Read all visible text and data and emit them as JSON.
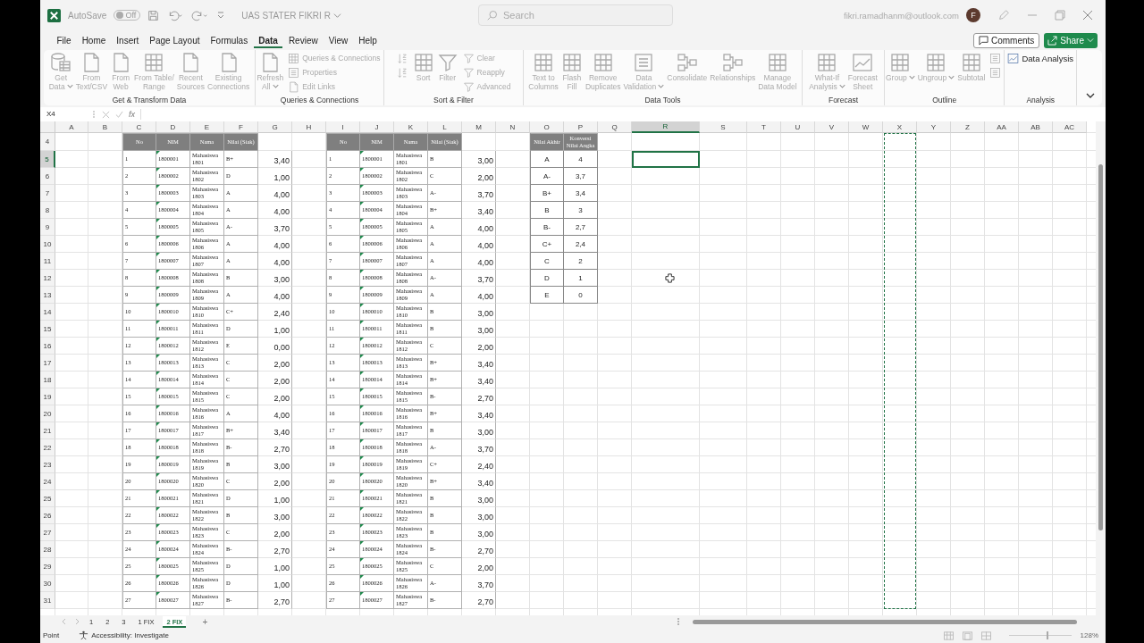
{
  "title_bar": {
    "autosave_label": "AutoSave",
    "autosave": {
      "label": "Off",
      "on": false
    },
    "file_name": "UAS STATER FIKRI R",
    "search": {
      "placeholder": "Search"
    },
    "account": "fikri.ramadhanm@outlook.com",
    "avatar": "F"
  },
  "menu_tabs": [
    {
      "label": "File",
      "selected": false
    },
    {
      "label": "Home",
      "selected": false
    },
    {
      "label": "Insert",
      "selected": false
    },
    {
      "label": "Page Layout",
      "selected": false
    },
    {
      "label": "Formulas",
      "selected": false
    },
    {
      "label": "Data",
      "selected": true
    },
    {
      "label": "Review",
      "selected": false
    },
    {
      "label": "View",
      "selected": false
    },
    {
      "label": "Help",
      "selected": false
    }
  ],
  "comments": "Comments",
  "share": "Share",
  "ribbon": [
    {
      "label": "Get & Transform Data",
      "items": [
        {
          "kind": "large",
          "label": "Get\nData",
          "menu": true,
          "disabled": true
        },
        {
          "kind": "large",
          "label": "From\nText/CSV",
          "menu": false,
          "disabled": true
        },
        {
          "kind": "large",
          "label": "From\nWeb",
          "menu": false,
          "disabled": true
        },
        {
          "kind": "large",
          "label": "From Table/\nRange",
          "menu": false,
          "disabled": true
        },
        {
          "kind": "large",
          "label": "Recent\nSources",
          "menu": false,
          "disabled": true
        },
        {
          "kind": "large",
          "label": "Existing\nConnections",
          "menu": false,
          "disabled": true
        }
      ]
    },
    {
      "label": "Queries & Connections",
      "items": [
        {
          "kind": "large",
          "label": "Refresh\nAll",
          "menu": true,
          "disabled": true
        },
        {
          "kind": "stack",
          "items": [
            {
              "label": "Queries & Connections",
              "disabled": true
            },
            {
              "label": "Properties",
              "disabled": true
            },
            {
              "label": "Edit Links",
              "disabled": true
            }
          ]
        }
      ]
    },
    {
      "label": "Sort & Filter",
      "items": [
        {
          "kind": "stack",
          "items": [
            {
              "disabled": true
            },
            {
              "disabled": true
            }
          ]
        },
        {
          "kind": "large",
          "label": "Sort",
          "menu": false,
          "disabled": true
        },
        {
          "kind": "large",
          "label": "Filter",
          "menu": false,
          "disabled": true
        },
        {
          "kind": "stack",
          "items": [
            {
              "label": "Clear",
              "disabled": true
            },
            {
              "label": "Reapply",
              "disabled": true
            },
            {
              "label": "Advanced",
              "disabled": true
            }
          ]
        }
      ]
    },
    {
      "label": "Data Tools",
      "items": [
        {
          "kind": "large",
          "label": "Text to\nColumns",
          "menu": false,
          "disabled": true
        },
        {
          "kind": "large",
          "label": "Flash\nFill",
          "menu": false,
          "disabled": true
        },
        {
          "kind": "large",
          "label": "Remove\nDuplicates",
          "menu": false,
          "disabled": true
        },
        {
          "kind": "large",
          "label": "Data\nValidation",
          "menu": true,
          "disabled": true
        },
        {
          "kind": "large",
          "label": "Consolidate",
          "menu": false,
          "disabled": true
        },
        {
          "kind": "large",
          "label": "Relationships",
          "menu": false,
          "disabled": true
        },
        {
          "kind": "large",
          "label": "Manage\nData Model",
          "menu": false,
          "disabled": true
        }
      ]
    },
    {
      "label": "Forecast",
      "items": [
        {
          "kind": "large",
          "label": "What-If\nAnalysis",
          "menu": true,
          "disabled": true
        },
        {
          "kind": "large",
          "label": "Forecast\nSheet",
          "menu": false,
          "disabled": true
        }
      ]
    },
    {
      "label": "Outline",
      "items": [
        {
          "kind": "large",
          "label": "Group",
          "menu": true,
          "disabled": true
        },
        {
          "kind": "large",
          "label": "Ungroup",
          "menu": true,
          "disabled": true
        },
        {
          "kind": "large",
          "label": "Subtotal",
          "menu": false,
          "disabled": true
        },
        {
          "kind": "stack",
          "items": [
            {
              "disabled": true
            },
            {
              "disabled": true
            }
          ]
        }
      ]
    },
    {
      "label": "Analysis",
      "items": [
        {
          "kind": "stack",
          "items": [
            {
              "label": "Data Analysis",
              "disabled": false
            }
          ]
        }
      ]
    }
  ],
  "formula_bar": {
    "name_box": "X4",
    "fx": "fx"
  },
  "sheet": {
    "column_headers": [
      {
        "label": "A",
        "selected": false,
        "copied": false
      },
      {
        "label": "B",
        "selected": false,
        "copied": false
      },
      {
        "label": "C",
        "selected": false,
        "copied": false
      },
      {
        "label": "D",
        "selected": false,
        "copied": false
      },
      {
        "label": "E",
        "selected": false,
        "copied": false
      },
      {
        "label": "F",
        "selected": false,
        "copied": false
      },
      {
        "label": "G",
        "selected": false,
        "copied": false
      },
      {
        "label": "H",
        "selected": false,
        "copied": false
      },
      {
        "label": "I",
        "selected": false,
        "copied": false
      },
      {
        "label": "J",
        "selected": false,
        "copied": false
      },
      {
        "label": "K",
        "selected": false,
        "copied": false
      },
      {
        "label": "L",
        "selected": false,
        "copied": false
      },
      {
        "label": "M",
        "selected": false,
        "copied": false
      },
      {
        "label": "N",
        "selected": false,
        "copied": false
      },
      {
        "label": "O",
        "selected": false,
        "copied": false
      },
      {
        "label": "P",
        "selected": false,
        "copied": false
      },
      {
        "label": "Q",
        "selected": false,
        "copied": false
      },
      {
        "label": "R",
        "selected": true,
        "copied": false
      },
      {
        "label": "S",
        "selected": false,
        "copied": false
      },
      {
        "label": "T",
        "selected": false,
        "copied": false
      },
      {
        "label": "U",
        "selected": false,
        "copied": false
      },
      {
        "label": "V",
        "selected": false,
        "copied": false
      },
      {
        "label": "W",
        "selected": false,
        "copied": false
      },
      {
        "label": "X",
        "selected": false,
        "copied": true
      },
      {
        "label": "Y",
        "selected": false,
        "copied": false
      },
      {
        "label": "Z",
        "selected": false,
        "copied": false
      },
      {
        "label": "AA",
        "selected": false,
        "copied": false
      },
      {
        "label": "AB",
        "selected": false,
        "copied": false
      },
      {
        "label": "AC",
        "selected": false,
        "copied": false
      }
    ],
    "row_headers": [
      {
        "label": "4",
        "selected": false
      },
      {
        "label": "5",
        "selected": true
      },
      {
        "label": "6",
        "selected": false
      },
      {
        "label": "7",
        "selected": false
      },
      {
        "label": "8",
        "selected": false
      },
      {
        "label": "9",
        "selected": false
      },
      {
        "label": "10",
        "selected": false
      },
      {
        "label": "11",
        "selected": false
      },
      {
        "label": "12",
        "selected": false
      },
      {
        "label": "13",
        "selected": false
      },
      {
        "label": "14",
        "selected": false
      },
      {
        "label": "15",
        "selected": false
      },
      {
        "label": "16",
        "selected": false
      },
      {
        "label": "17",
        "selected": false
      },
      {
        "label": "18",
        "selected": false
      },
      {
        "label": "19",
        "selected": false
      },
      {
        "label": "20",
        "selected": false
      },
      {
        "label": "21",
        "selected": false
      },
      {
        "label": "22",
        "selected": false
      },
      {
        "label": "23",
        "selected": false
      },
      {
        "label": "24",
        "selected": false
      },
      {
        "label": "25",
        "selected": false
      },
      {
        "label": "26",
        "selected": false
      },
      {
        "label": "27",
        "selected": false
      },
      {
        "label": "28",
        "selected": false
      },
      {
        "label": "29",
        "selected": false
      },
      {
        "label": "30",
        "selected": false
      },
      {
        "label": "31",
        "selected": false
      }
    ],
    "tables": [
      {
        "columns": [
          "No",
          "NIM",
          "Nama",
          "Nilai (Siak)"
        ],
        "rows": [
          {
            "no": "1",
            "nim": "1800001",
            "name": "Mahasiswa 1801",
            "grade": "B+",
            "score": "3,40"
          },
          {
            "no": "2",
            "nim": "1800002",
            "name": "Mahasiswa 1802",
            "grade": "D",
            "score": "1,00"
          },
          {
            "no": "3",
            "nim": "1800003",
            "name": "Mahasiswa 1803",
            "grade": "A",
            "score": "4,00"
          },
          {
            "no": "4",
            "nim": "1800004",
            "name": "Mahasiswa 1804",
            "grade": "A",
            "score": "4,00"
          },
          {
            "no": "5",
            "nim": "1800005",
            "name": "Mahasiswa 1805",
            "grade": "A-",
            "score": "3,70"
          },
          {
            "no": "6",
            "nim": "1800006",
            "name": "Mahasiswa 1806",
            "grade": "A",
            "score": "4,00"
          },
          {
            "no": "7",
            "nim": "1800007",
            "name": "Mahasiswa 1807",
            "grade": "A",
            "score": "4,00"
          },
          {
            "no": "8",
            "nim": "1800008",
            "name": "Mahasiswa 1808",
            "grade": "B",
            "score": "3,00"
          },
          {
            "no": "9",
            "nim": "1800009",
            "name": "Mahasiswa 1809",
            "grade": "A",
            "score": "4,00"
          },
          {
            "no": "10",
            "nim": "1800010",
            "name": "Mahasiswa 1810",
            "grade": "C+",
            "score": "2,40"
          },
          {
            "no": "11",
            "nim": "1800011",
            "name": "Mahasiswa 1811",
            "grade": "D",
            "score": "1,00"
          },
          {
            "no": "12",
            "nim": "1800012",
            "name": "Mahasiswa 1812",
            "grade": "E",
            "score": "0,00"
          },
          {
            "no": "13",
            "nim": "1800013",
            "name": "Mahasiswa 1813",
            "grade": "C",
            "score": "2,00"
          },
          {
            "no": "14",
            "nim": "1800014",
            "name": "Mahasiswa 1814",
            "grade": "C",
            "score": "2,00"
          },
          {
            "no": "15",
            "nim": "1800015",
            "name": "Mahasiswa 1815",
            "grade": "C",
            "score": "2,00"
          },
          {
            "no": "16",
            "nim": "1800016",
            "name": "Mahasiswa 1816",
            "grade": "A",
            "score": "4,00"
          },
          {
            "no": "17",
            "nim": "1800017",
            "name": "Mahasiswa 1817",
            "grade": "B+",
            "score": "3,40"
          },
          {
            "no": "18",
            "nim": "1800018",
            "name": "Mahasiswa 1818",
            "grade": "B-",
            "score": "2,70"
          },
          {
            "no": "19",
            "nim": "1800019",
            "name": "Mahasiswa 1819",
            "grade": "B",
            "score": "3,00"
          },
          {
            "no": "20",
            "nim": "1800020",
            "name": "Mahasiswa 1820",
            "grade": "C",
            "score": "2,00"
          },
          {
            "no": "21",
            "nim": "1800021",
            "name": "Mahasiswa 1821",
            "grade": "D",
            "score": "1,00"
          },
          {
            "no": "22",
            "nim": "1800022",
            "name": "Mahasiswa 1822",
            "grade": "B",
            "score": "3,00"
          },
          {
            "no": "23",
            "nim": "1800023",
            "name": "Mahasiswa 1823",
            "grade": "C",
            "score": "2,00"
          },
          {
            "no": "24",
            "nim": "1800024",
            "name": "Mahasiswa 1824",
            "grade": "B-",
            "score": "2,70"
          },
          {
            "no": "25",
            "nim": "1800025",
            "name": "Mahasiswa 1825",
            "grade": "D",
            "score": "1,00"
          },
          {
            "no": "26",
            "nim": "1800026",
            "name": "Mahasiswa 1826",
            "grade": "D",
            "score": "1,00"
          },
          {
            "no": "27",
            "nim": "1800027",
            "name": "Mahasiswa 1827",
            "grade": "B-",
            "score": "2,70"
          }
        ]
      },
      {
        "columns": [
          "No",
          "NIM",
          "Nama",
          "Nilai (Siak)"
        ],
        "rows": [
          {
            "no": "1",
            "nim": "1800001",
            "name": "Mahasiswa 1801",
            "grade": "B",
            "score": "3,00"
          },
          {
            "no": "2",
            "nim": "1800002",
            "name": "Mahasiswa 1802",
            "grade": "C",
            "score": "2,00"
          },
          {
            "no": "3",
            "nim": "1800003",
            "name": "Mahasiswa 1803",
            "grade": "A-",
            "score": "3,70"
          },
          {
            "no": "4",
            "nim": "1800004",
            "name": "Mahasiswa 1804",
            "grade": "B+",
            "score": "3,40"
          },
          {
            "no": "5",
            "nim": "1800005",
            "name": "Mahasiswa 1805",
            "grade": "A",
            "score": "4,00"
          },
          {
            "no": "6",
            "nim": "1800006",
            "name": "Mahasiswa 1806",
            "grade": "A",
            "score": "4,00"
          },
          {
            "no": "7",
            "nim": "1800007",
            "name": "Mahasiswa 1807",
            "grade": "A",
            "score": "4,00"
          },
          {
            "no": "8",
            "nim": "1800008",
            "name": "Mahasiswa 1808",
            "grade": "A-",
            "score": "3,70"
          },
          {
            "no": "9",
            "nim": "1800009",
            "name": "Mahasiswa 1809",
            "grade": "A",
            "score": "4,00"
          },
          {
            "no": "10",
            "nim": "1800010",
            "name": "Mahasiswa 1810",
            "grade": "B",
            "score": "3,00"
          },
          {
            "no": "11",
            "nim": "1800011",
            "name": "Mahasiswa 1811",
            "grade": "B",
            "score": "3,00"
          },
          {
            "no": "12",
            "nim": "1800012",
            "name": "Mahasiswa 1812",
            "grade": "C",
            "score": "2,00"
          },
          {
            "no": "13",
            "nim": "1800013",
            "name": "Mahasiswa 1813",
            "grade": "B+",
            "score": "3,40"
          },
          {
            "no": "14",
            "nim": "1800014",
            "name": "Mahasiswa 1814",
            "grade": "B+",
            "score": "3,40"
          },
          {
            "no": "15",
            "nim": "1800015",
            "name": "Mahasiswa 1815",
            "grade": "B-",
            "score": "2,70"
          },
          {
            "no": "16",
            "nim": "1800016",
            "name": "Mahasiswa 1816",
            "grade": "B+",
            "score": "3,40"
          },
          {
            "no": "17",
            "nim": "1800017",
            "name": "Mahasiswa 1817",
            "grade": "B",
            "score": "3,00"
          },
          {
            "no": "18",
            "nim": "1800018",
            "name": "Mahasiswa 1818",
            "grade": "A-",
            "score": "3,70"
          },
          {
            "no": "19",
            "nim": "1800019",
            "name": "Mahasiswa 1819",
            "grade": "C+",
            "score": "2,40"
          },
          {
            "no": "20",
            "nim": "1800020",
            "name": "Mahasiswa 1820",
            "grade": "B+",
            "score": "3,40"
          },
          {
            "no": "21",
            "nim": "1800021",
            "name": "Mahasiswa 1821",
            "grade": "B",
            "score": "3,00"
          },
          {
            "no": "22",
            "nim": "1800022",
            "name": "Mahasiswa 1822",
            "grade": "B",
            "score": "3,00"
          },
          {
            "no": "23",
            "nim": "1800023",
            "name": "Mahasiswa 1823",
            "grade": "B",
            "score": "3,00"
          },
          {
            "no": "24",
            "nim": "1800024",
            "name": "Mahasiswa 1824",
            "grade": "B-",
            "score": "2,70"
          },
          {
            "no": "25",
            "nim": "1800025",
            "name": "Mahasiswa 1825",
            "grade": "C",
            "score": "2,00"
          },
          {
            "no": "26",
            "nim": "1800026",
            "name": "Mahasiswa 1826",
            "grade": "A-",
            "score": "3,70"
          },
          {
            "no": "27",
            "nim": "1800027",
            "name": "Mahasiswa 1827",
            "grade": "B-",
            "score": "2,70"
          }
        ]
      }
    ],
    "conversion": {
      "columns": [
        "Nilai Akhir",
        "Konversi Nilai Angka"
      ],
      "rows": [
        {
          "grade": "A",
          "value": "4"
        },
        {
          "grade": "A-",
          "value": "3,7"
        },
        {
          "grade": "B+",
          "value": "3,4"
        },
        {
          "grade": "B",
          "value": "3"
        },
        {
          "grade": "B-",
          "value": "2,7"
        },
        {
          "grade": "C+",
          "value": "2,4"
        },
        {
          "grade": "C",
          "value": "2"
        },
        {
          "grade": "D",
          "value": "1"
        },
        {
          "grade": "E",
          "value": "0"
        }
      ]
    }
  },
  "sheet_tabs": [
    {
      "label": "1",
      "selected": false
    },
    {
      "label": "2",
      "selected": false
    },
    {
      "label": "3",
      "selected": false
    },
    {
      "label": "1 FIX",
      "selected": false
    },
    {
      "label": "2 FIX",
      "selected": true
    }
  ],
  "add_sheet": "+",
  "status_bar": {
    "mode": "Point",
    "accessibility": "Accessibility: Investigate",
    "zoom_slider": {
      "level": 0.6
    },
    "zoom": "128%"
  }
}
